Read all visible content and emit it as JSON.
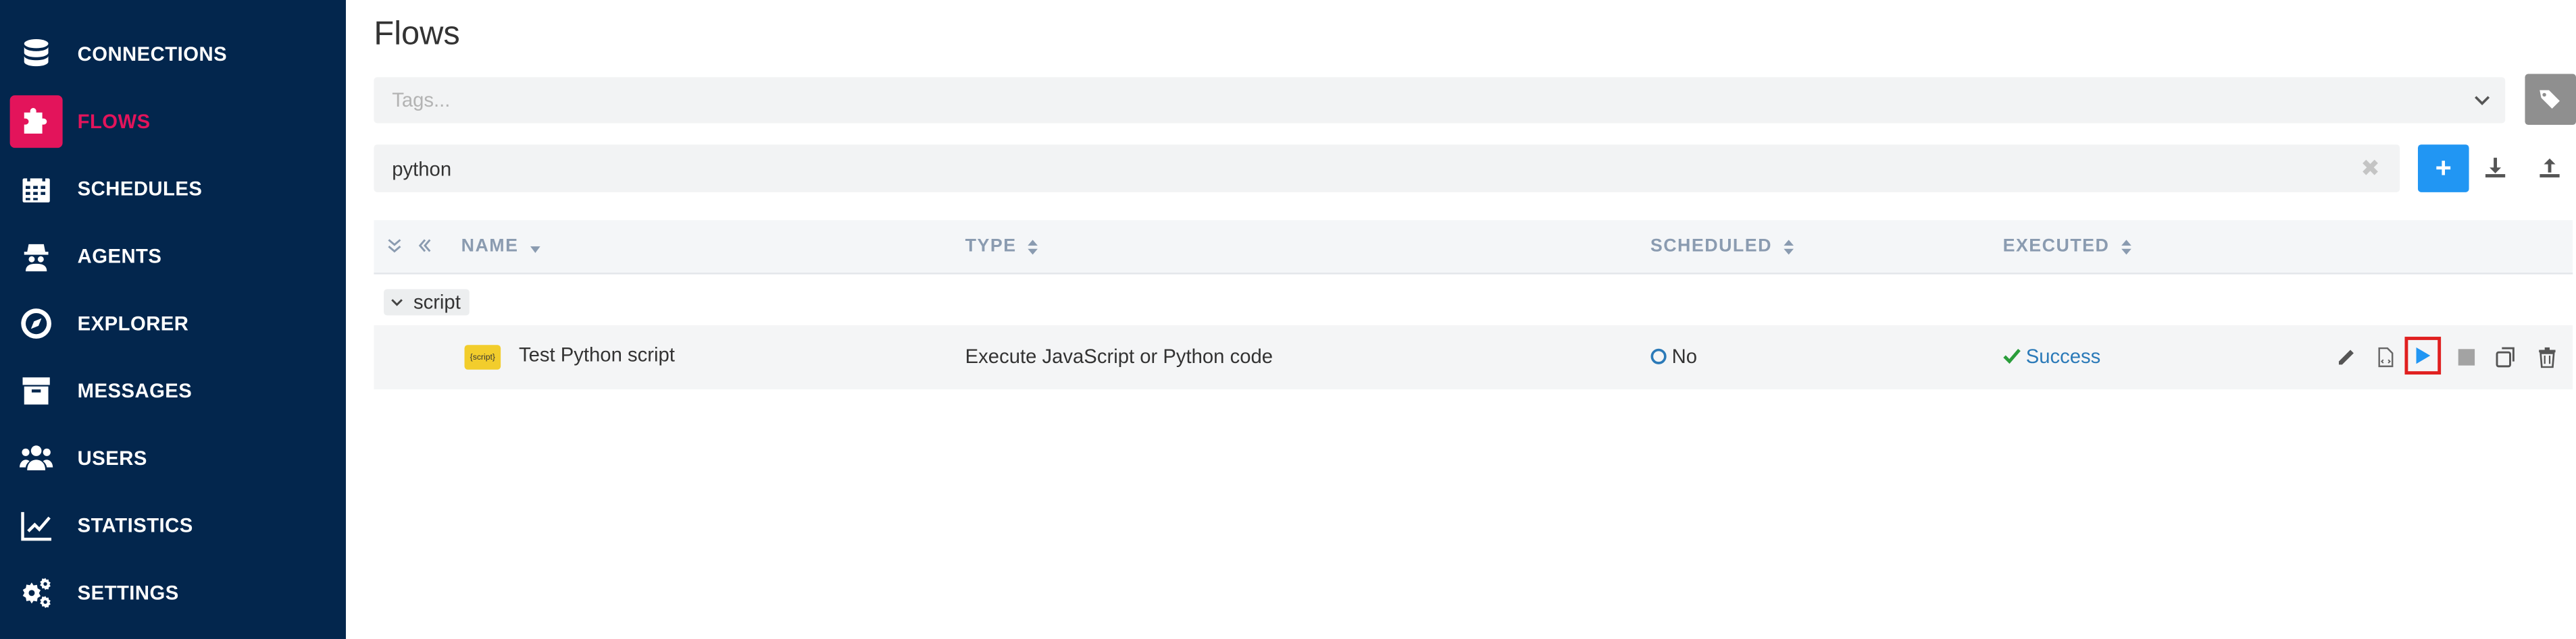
{
  "sidebar": {
    "items": [
      {
        "label": "CONNECTIONS",
        "icon": "database-icon"
      },
      {
        "label": "FLOWS",
        "icon": "puzzle-icon",
        "active": true
      },
      {
        "label": "SCHEDULES",
        "icon": "calendar-icon"
      },
      {
        "label": "AGENTS",
        "icon": "agent-icon"
      },
      {
        "label": "EXPLORER",
        "icon": "compass-icon"
      },
      {
        "label": "MESSAGES",
        "icon": "archive-icon"
      },
      {
        "label": "USERS",
        "icon": "users-icon"
      },
      {
        "label": "STATISTICS",
        "icon": "chart-line-icon"
      },
      {
        "label": "SETTINGS",
        "icon": "gears-icon"
      }
    ],
    "background": "#03264d",
    "accent": "#e3145b"
  },
  "page": {
    "title": "Flows"
  },
  "tags": {
    "placeholder": "Tags..."
  },
  "search": {
    "value": "python",
    "clear": "✖"
  },
  "toolbar": {
    "add_label": "+",
    "accent": "#2196f3"
  },
  "table": {
    "columns": {
      "name": "NAME",
      "type": "TYPE",
      "scheduled": "SCHEDULED",
      "executed": "EXECUTED"
    },
    "groups": [
      {
        "name": "script",
        "rows": [
          {
            "badge": "{script}",
            "name": "Test Python script",
            "type": "Execute JavaScript or Python code",
            "scheduled": "No",
            "executed": "Success"
          }
        ]
      }
    ]
  },
  "colors": {
    "success": "#2a9d3a",
    "success_text": "#2b7ab8",
    "scheduled_ring": "#2b7ab8"
  }
}
